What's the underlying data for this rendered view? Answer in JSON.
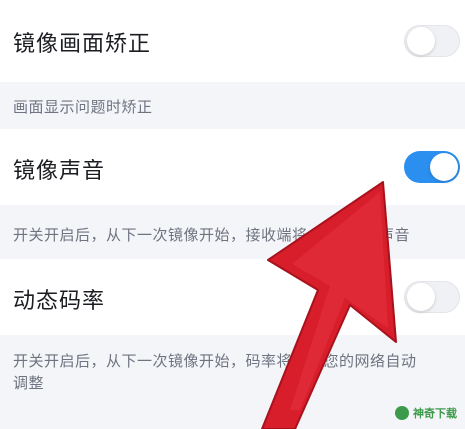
{
  "settings": {
    "mirror_correction": {
      "title": "镜像画面矫正",
      "toggle": "off",
      "note": "画面显示问题时矫正"
    },
    "mirror_sound": {
      "title": "镜像声音",
      "toggle": "on",
      "note": "开关开启后，从下一次镜像开始，接收端将播放镜像的声音",
      "note_visible": "开关开启后，从下一次镜像开始，接收端将",
      "note_tail": "的声音"
    },
    "dynamic_bitrate": {
      "title": "动态码率",
      "toggle": "off",
      "note_line1": "开关开启后，从下一次镜像开始，码率将",
      "note_line1_tail": "据您的网络自动",
      "note_line2": "调整"
    }
  },
  "colors": {
    "accent": "#2b8ff0",
    "arrow": "#d81d2b"
  },
  "watermark": {
    "text": "神奇下载",
    "icon": "leaf-icon"
  }
}
